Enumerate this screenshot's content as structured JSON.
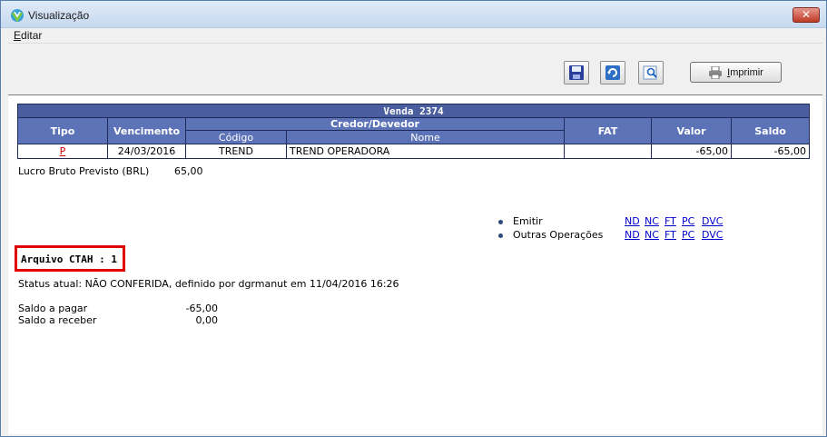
{
  "window": {
    "title": "Visualização",
    "close_label": "✕"
  },
  "menu": {
    "editar_first": "E",
    "editar_rest": "ditar"
  },
  "toolbar": {
    "print_label": "Imprimir",
    "print_first": "I",
    "print_rest": "mprimir"
  },
  "venda": {
    "title": "Venda 2374",
    "headers": {
      "tipo": "Tipo",
      "vencimento": "Vencimento",
      "credor": "Credor/Devedor",
      "codigo": "Código",
      "nome": "Nome",
      "fat": "FAT",
      "valor": "Valor",
      "saldo": "Saldo"
    },
    "rows": [
      {
        "tipo": "P",
        "vencimento": "24/03/2016",
        "codigo": "TREND",
        "nome": "TREND OPERADORA",
        "fat": "",
        "valor": "-65,00",
        "saldo": "-65,00"
      }
    ]
  },
  "lucro": {
    "label": "Lucro Bruto Previsto (BRL)",
    "value": "65,00"
  },
  "operations": [
    {
      "label": "Emitir",
      "links": [
        "ND",
        "NC",
        "FT",
        "PC",
        "DVC"
      ]
    },
    {
      "label": "Outras Operações",
      "links": [
        "ND",
        "NC",
        "FT",
        "PC",
        "DVC"
      ]
    }
  ],
  "arquivo": "Arquivo CTAH : 1",
  "status": "Status atual: NÃO CONFERIDA, definido por dgrmanut em 11/04/2016 16:26",
  "saldos": [
    {
      "label": "Saldo a pagar",
      "value": "-65,00"
    },
    {
      "label": "Saldo a receber",
      "value": "0,00"
    }
  ],
  "colors": {
    "table_header": "#5d73b8",
    "table_title": "#4a5d9e",
    "highlight": "#e00000",
    "link": "#0000cc"
  }
}
